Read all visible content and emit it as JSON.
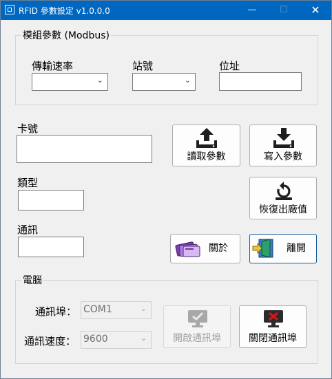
{
  "window": {
    "title": "RFID 參數設定 v1.0.0.0"
  },
  "titlebar": {
    "minimize": "—",
    "maximize": "☐",
    "close": "✕"
  },
  "module_group": {
    "title": "模組參數 (Modbus)",
    "baud_label": "傳輸速率",
    "station_label": "站號",
    "address_label": "位址"
  },
  "card_label": "卡號",
  "type_label": "類型",
  "comm_label": "通訊",
  "buttons": {
    "read_params": "讀取參數",
    "write_params": "寫入參數",
    "restore_defaults": "恢復出廠值",
    "about": "關於",
    "exit": "離開",
    "open_port": "開啟通訊埠",
    "close_port": "關閉通訊埠"
  },
  "computer_group": {
    "title": "電腦",
    "port_label": "通訊埠：",
    "port_value": "COM1",
    "speed_label": "通訊速度：",
    "speed_value": "9600"
  },
  "colors": {
    "titlebar": "#0067c0",
    "icon_dark": "#1e1e1e",
    "close_red": "#d01818"
  },
  "icons": [
    "upload-icon",
    "download-icon",
    "restore-icon",
    "cards-icon",
    "exit-door-icon",
    "monitor-check-icon",
    "monitor-close-icon"
  ]
}
